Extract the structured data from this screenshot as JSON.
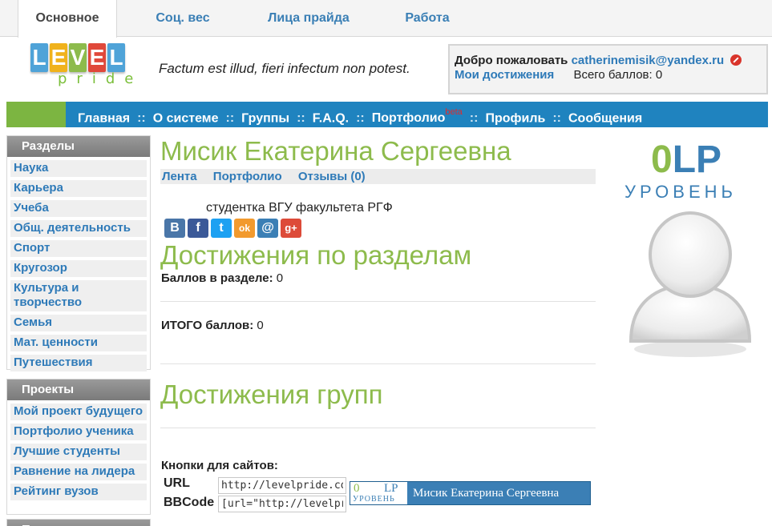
{
  "tabs": [
    "Основное",
    "Соц. вес",
    "Лица прайда",
    "Работа"
  ],
  "logo": {
    "letters": [
      "L",
      "E",
      "V",
      "E",
      "L"
    ],
    "sub": "pride"
  },
  "motto": "Factum est illud, fieri infectum non potest.",
  "welcome": {
    "greeting": "Добро пожаловать",
    "email": "catherinemisik@yandex.ru",
    "achievements": "Мои достижения",
    "total": "Всего баллов: 0"
  },
  "nav": {
    "items": [
      "Главная",
      "О системе",
      "Группы",
      "F.A.Q.",
      "Портфолио",
      "Профиль",
      "Сообщения"
    ],
    "separator": "::",
    "beta": "beta"
  },
  "sidebar": {
    "sections_title": "Разделы",
    "sections": [
      "Наука",
      "Карьера",
      "Учеба",
      "Общ. деятельность",
      "Спорт",
      "Кругозор",
      "Культура и творчество",
      "Семья",
      "Мат. ценности",
      "Путешествия"
    ],
    "projects_title": "Проекты",
    "projects": [
      "Мой проект будущего",
      "Портфолио ученика",
      "Лучшие студенты",
      "Равнение на лидера",
      "Рейтинг вузов"
    ],
    "third_title": "П..."
  },
  "profile": {
    "name": "Мисик Екатерина Сергеевна",
    "subtabs": [
      "Лента",
      "Портфолио",
      "Отзывы (0)"
    ],
    "status": "студентка ВГУ факультета РГФ"
  },
  "share_icons": [
    "В",
    "f",
    "t",
    "ok",
    "@",
    "g+"
  ],
  "achievements": {
    "title": "Достижения по разделам",
    "section_points_label": "Баллов в разделе:",
    "section_points_value": "0",
    "total_label": "ИТОГО баллов:",
    "total_value": "0",
    "groups_title": "Достижения групп"
  },
  "site_buttons": {
    "title": "Кнопки для сайтов:",
    "url_label": "URL",
    "url_value": "http://levelpride.com",
    "bbcode_label": "BBCode",
    "bbcode_value": "[url=\"http://levelpride.com",
    "badge": {
      "level": "0",
      "lp": "LP",
      "word": "УРОВЕНЬ",
      "name": "Мисик Екатерина Сергеевна"
    }
  },
  "level": {
    "value": "0",
    "suffix": "LP",
    "word": "УРОВЕНЬ"
  },
  "colors": {
    "accent_blue": "#1f83bf",
    "accent_green": "#8dbb4c",
    "link": "#2e7ab8"
  }
}
